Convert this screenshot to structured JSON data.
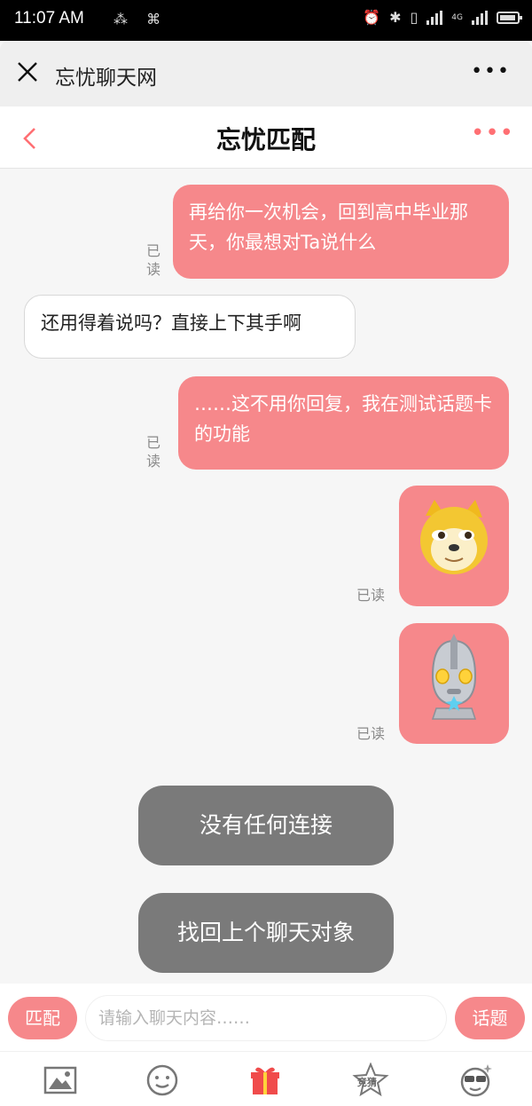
{
  "status_bar": {
    "time": "11:07 AM",
    "network": "4G"
  },
  "browser": {
    "title": "忘忧聊天网"
  },
  "header": {
    "title": "忘忧匹配"
  },
  "messages": [
    {
      "from": "me",
      "type": "text",
      "text": "再给你一次机会，回到高中毕业那天，你最想对Ta说什么",
      "status": "已读"
    },
    {
      "from": "other",
      "type": "text",
      "text": "还用得着说吗？直接上下其手啊"
    },
    {
      "from": "me",
      "type": "text",
      "text": "……这不用你回复，我在测试话题卡的功能",
      "status": "已读"
    },
    {
      "from": "me",
      "type": "sticker",
      "sticker": "doge-emoji",
      "status": "已读"
    },
    {
      "from": "me",
      "type": "sticker",
      "sticker": "ultraman-emoji",
      "status": "已读"
    }
  ],
  "system_buttons": {
    "no_connection": "没有任何连接",
    "find_last": "找回上个聊天对象"
  },
  "input_bar": {
    "match_label": "匹配",
    "placeholder": "请输入聊天内容……",
    "topic_label": "话题"
  },
  "toolbar": {
    "guess_label": "竞猜"
  },
  "colors": {
    "accent": "#f6888b",
    "system_button": "#7a7a7a"
  }
}
